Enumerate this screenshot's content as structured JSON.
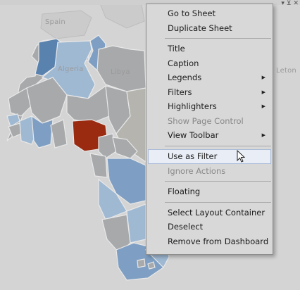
{
  "map": {
    "labels": [
      "Spain",
      "Algeria",
      "Libya",
      "Leton"
    ],
    "colors": {
      "background": "#d4d4d4",
      "neutral": "#a7a9ab",
      "light_blue": "#9fb9d3",
      "mid_blue": "#7e9fc3",
      "dark_blue": "#5a82ae",
      "highlight": "#9a2a10",
      "border": "#e6e6e6"
    }
  },
  "corner_tools": {
    "dropdown_glyph": "▾",
    "filter_glyph": "⊻",
    "close_glyph": "✕"
  },
  "menu": {
    "groups": [
      [
        {
          "label": "Go to Sheet",
          "disabled": false,
          "submenu": false
        },
        {
          "label": "Duplicate Sheet",
          "disabled": false,
          "submenu": false
        }
      ],
      [
        {
          "label": "Title",
          "disabled": false,
          "submenu": false
        },
        {
          "label": "Caption",
          "disabled": false,
          "submenu": false
        },
        {
          "label": "Legends",
          "disabled": false,
          "submenu": true
        },
        {
          "label": "Filters",
          "disabled": false,
          "submenu": true
        },
        {
          "label": "Highlighters",
          "disabled": false,
          "submenu": true
        },
        {
          "label": "Show Page Control",
          "disabled": true,
          "submenu": false
        },
        {
          "label": "View Toolbar",
          "disabled": false,
          "submenu": true
        }
      ],
      [
        {
          "label": "Use as Filter",
          "disabled": false,
          "submenu": false,
          "hovered": true
        },
        {
          "label": "Ignore Actions",
          "disabled": true,
          "submenu": false
        }
      ],
      [
        {
          "label": "Floating",
          "disabled": false,
          "submenu": false
        }
      ],
      [
        {
          "label": "Select Layout Container",
          "disabled": false,
          "submenu": false
        },
        {
          "label": "Deselect",
          "disabled": false,
          "submenu": false
        },
        {
          "label": "Remove from Dashboard",
          "disabled": false,
          "submenu": false
        }
      ]
    ],
    "submenu_arrow": "▶"
  }
}
